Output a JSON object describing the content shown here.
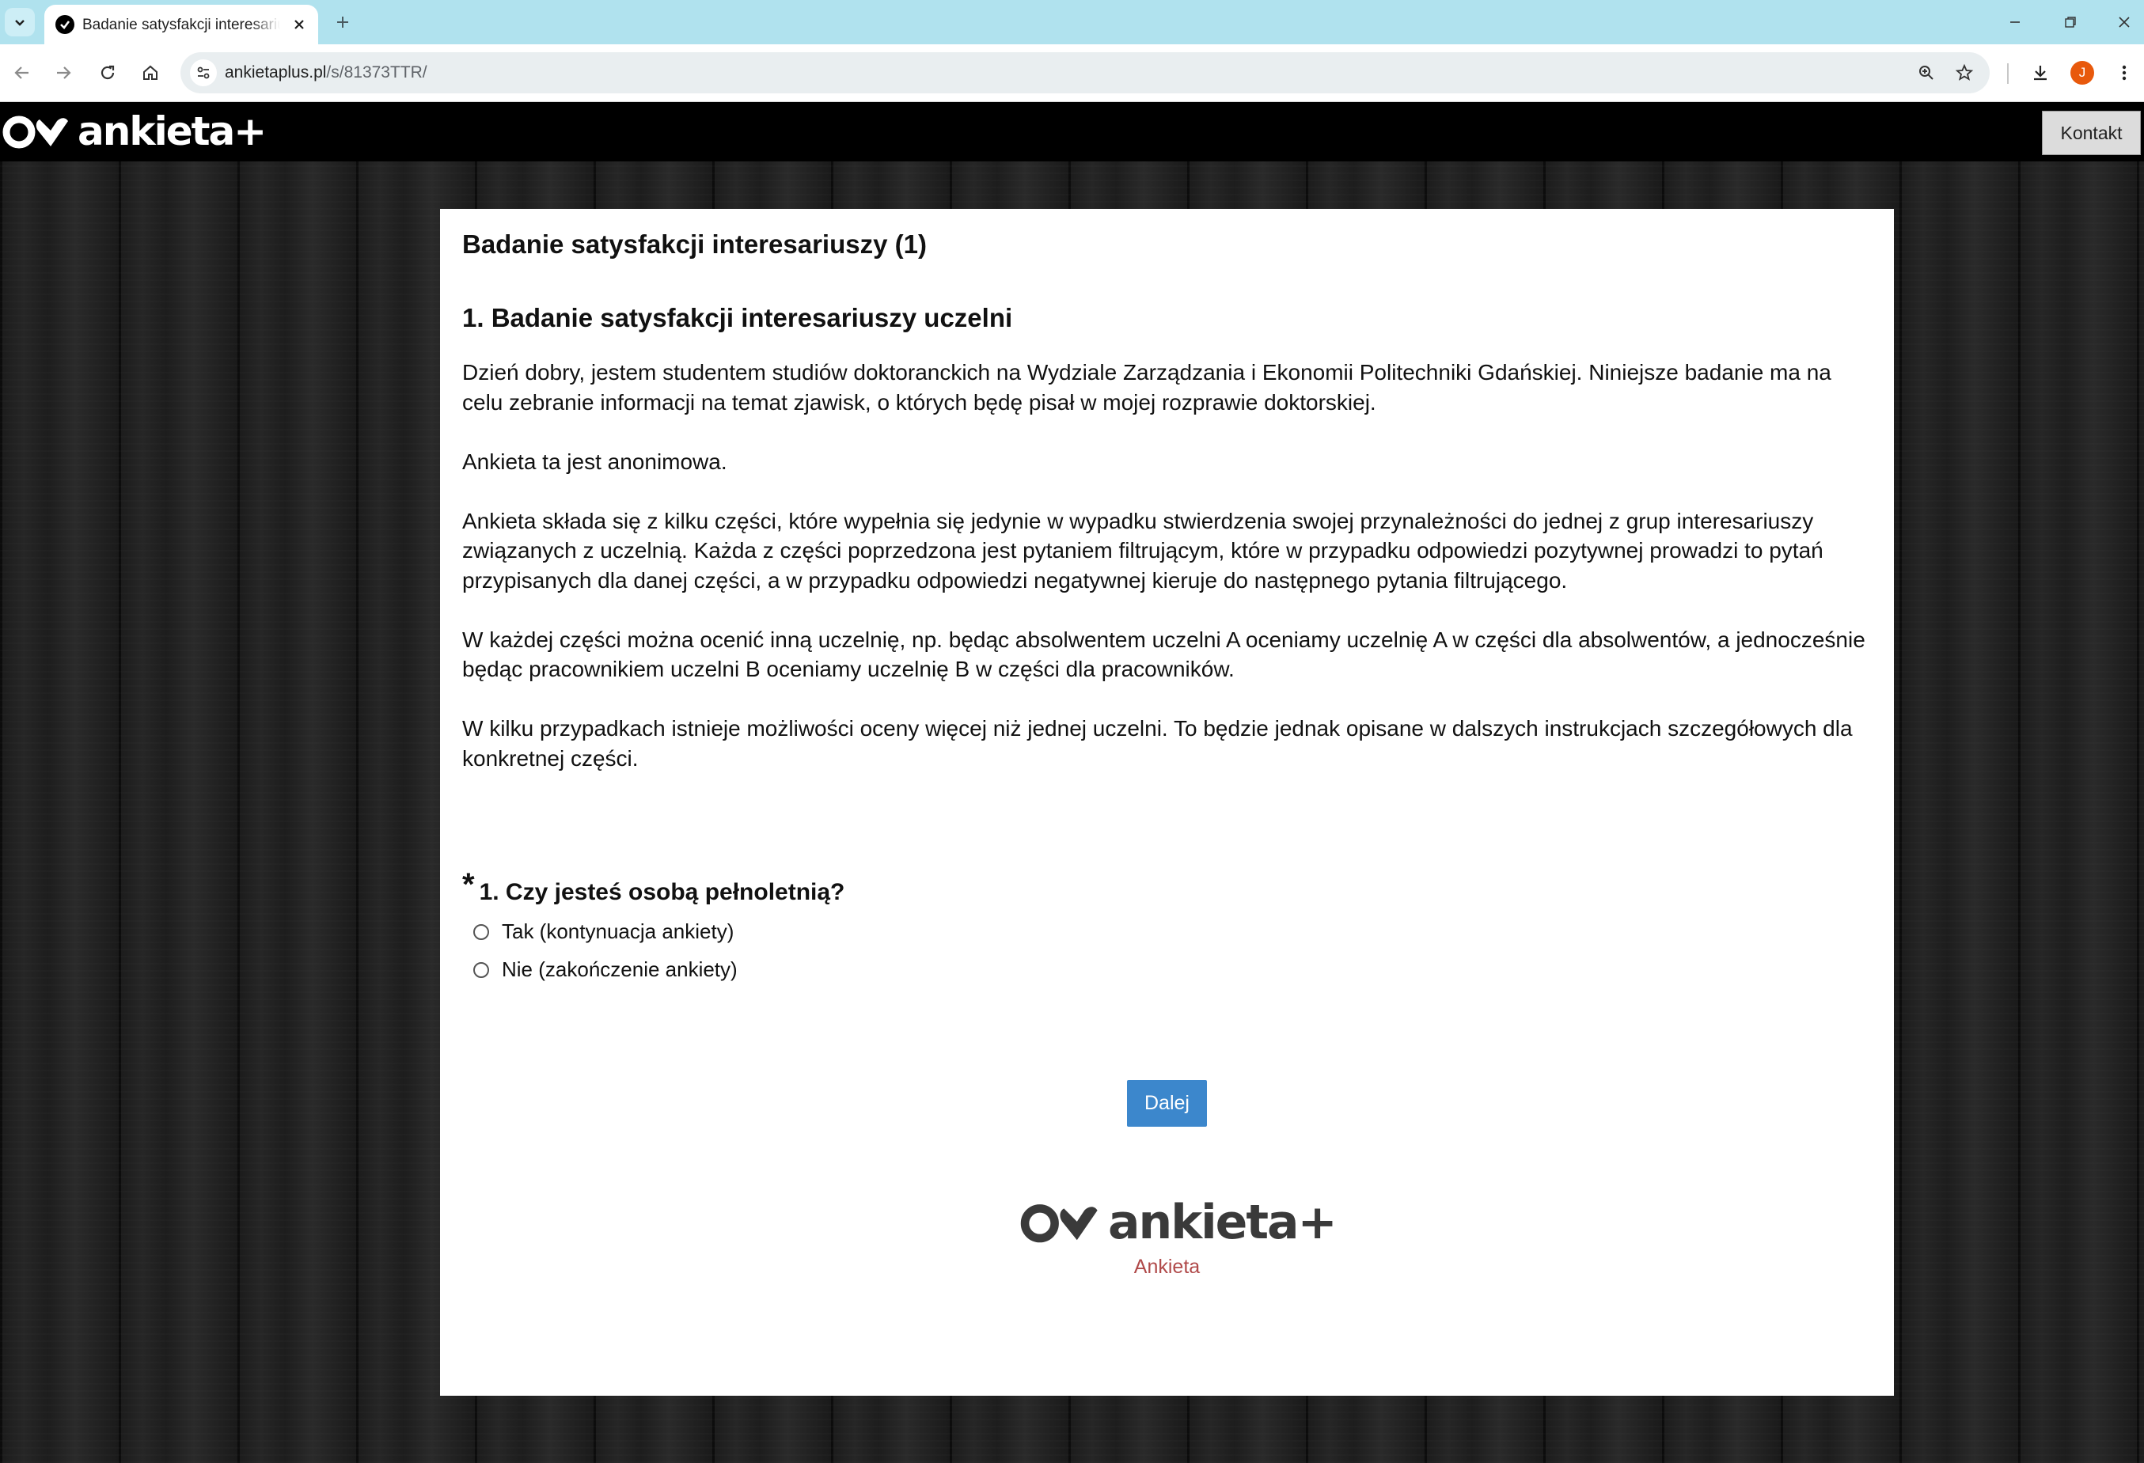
{
  "browser": {
    "tab_title": "Badanie satysfakcji interesariuszy (1)",
    "url_host": "ankietaplus.pl",
    "url_path": "/s/81373TTR/",
    "profile_initial": "J"
  },
  "site": {
    "logo_text": "ankieta+",
    "contact_label": "Kontakt"
  },
  "survey": {
    "title": "Badanie satysfakcji interesariuszy (1)",
    "section_title": "1. Badanie satysfakcji interesariuszy uczelni",
    "paragraphs": [
      "Dzień dobry, jestem studentem studiów doktoranckich na Wydziale Zarządzania i Ekonomii Politechniki Gdańskiej. Niniejsze badanie ma na celu zebranie informacji na temat zjawisk, o których będę pisał w mojej rozprawie doktorskiej.",
      "Ankieta ta jest anonimowa.",
      "Ankieta składa się z kilku części, które wypełnia się jedynie w wypadku stwierdzenia swojej przynależności do jednej z grup interesariuszy związanych z uczelnią. Każda z części poprzedzona jest pytaniem filtrującym, które w przypadku odpowiedzi pozytywnej prowadzi to pytań przypisanych dla danej części, a w przypadku odpowiedzi negatywnej kieruje do następnego pytania filtrującego.",
      "W każdej części można ocenić inną uczelnię, np. będąc absolwentem uczelni A oceniamy uczelnię A w części dla absolwentów, a jednocześnie będąc pracownikiem uczelni B oceniamy uczelnię B w części dla pracowników.",
      "W kilku przypadkach istnieje możliwości oceny więcej niż jednej uczelni. To będzie jednak opisane w dalszych instrukcjach szczegółowych dla konkretnej części."
    ],
    "question": {
      "required_marker": "*",
      "text": "1. Czy jesteś osobą pełnoletnią?",
      "options": [
        "Tak (kontynuacja ankiety)",
        "Nie (zakończenie ankiety)"
      ],
      "selected": null
    },
    "next_label": "Dalej",
    "footer_logo_text": "ankieta+",
    "footer_link": "Ankieta"
  },
  "colors": {
    "tabbar": "#b0e2ee",
    "button": "#3c87cc",
    "footer_link": "#b04a4a"
  }
}
